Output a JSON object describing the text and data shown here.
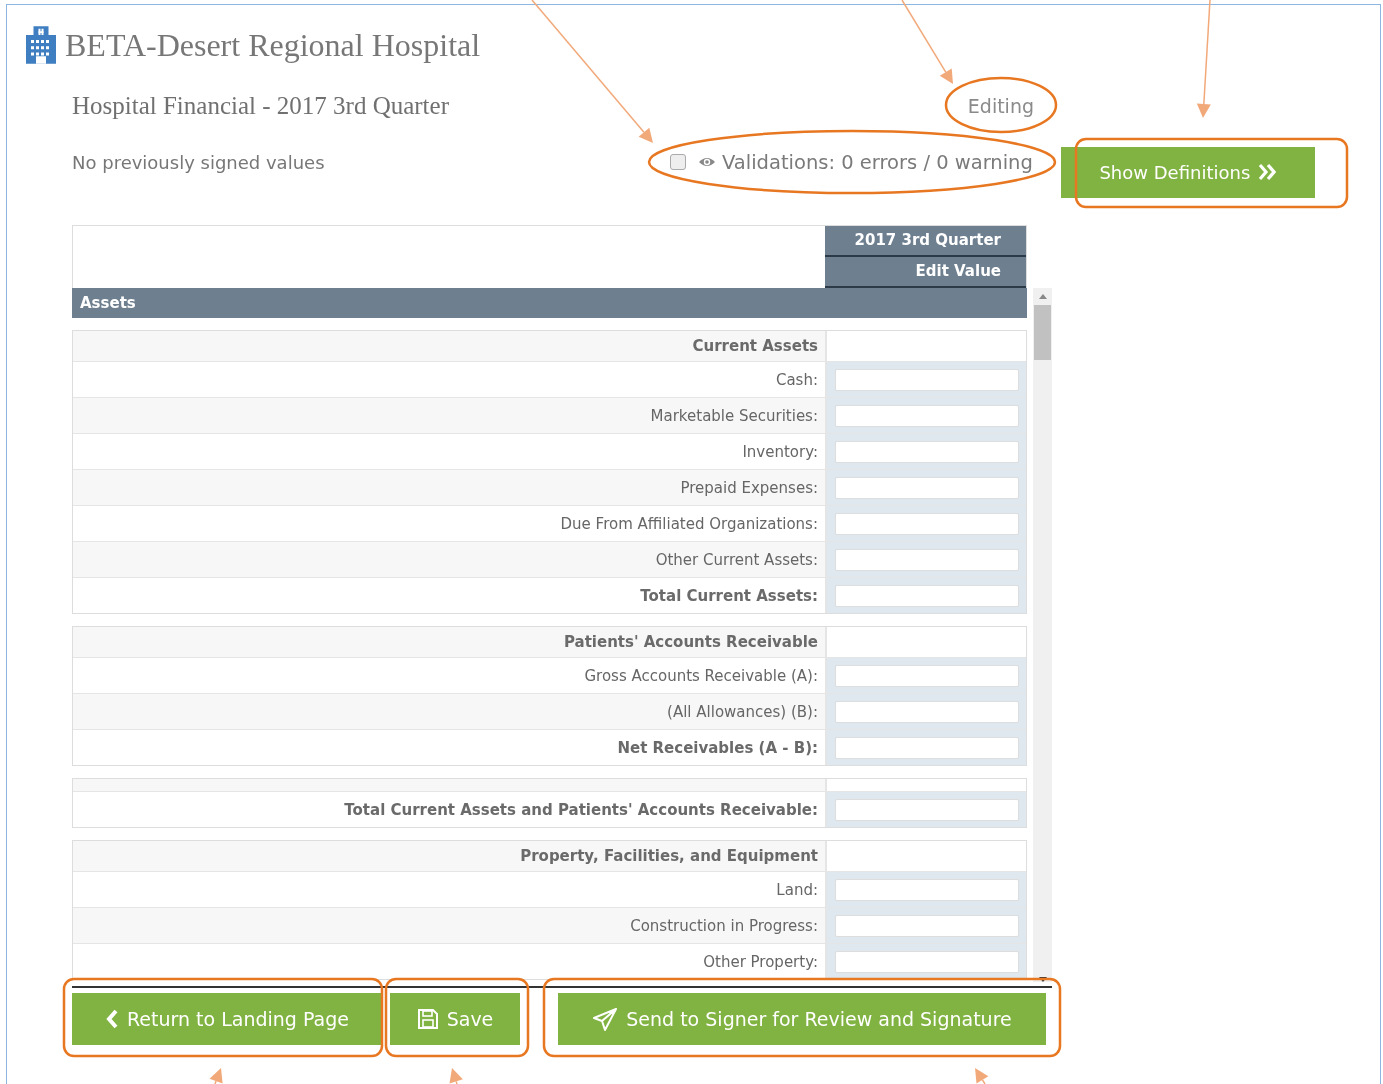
{
  "hospital": {
    "name": "BETA-Desert Regional Hospital"
  },
  "report": {
    "title": "Hospital Financial - 2017 3rd Quarter",
    "status": "Editing"
  },
  "signed_note": "No previously signed values",
  "validations": {
    "checked": false,
    "text": "Validations: 0 errors / 0 warning"
  },
  "show_definitions": "Show Definitions",
  "table": {
    "columns": [
      "2017 3rd Quarter",
      "Edit Value"
    ],
    "section": "Assets",
    "groups": [
      {
        "heading": "Current Assets",
        "rows": [
          {
            "label": "Cash:",
            "bold": false
          },
          {
            "label": "Marketable Securities:",
            "bold": false
          },
          {
            "label": "Inventory:",
            "bold": false
          },
          {
            "label": "Prepaid Expenses:",
            "bold": false
          },
          {
            "label": "Due From Affiliated Organizations:",
            "bold": false
          },
          {
            "label": "Other Current Assets:",
            "bold": false
          },
          {
            "label": "Total Current Assets:",
            "bold": true
          }
        ]
      },
      {
        "heading": "Patients' Accounts Receivable",
        "rows": [
          {
            "label": "Gross Accounts Receivable (A):",
            "bold": false
          },
          {
            "label": "(All Allowances) (B):",
            "bold": false
          },
          {
            "label": "Net Receivables (A - B):",
            "bold": true
          }
        ]
      },
      {
        "rows": [
          {
            "label": "Total Current Assets and Patients' Accounts Receivable:",
            "bold": true
          }
        ]
      },
      {
        "heading": "Property, Facilities, and Equipment",
        "rows": [
          {
            "label": "Land:",
            "bold": false
          },
          {
            "label": "Construction in Progress:",
            "bold": false
          },
          {
            "label": "Other Property:",
            "bold": false
          }
        ]
      }
    ]
  },
  "buttons": [
    {
      "label": "Return to Landing Page"
    },
    {
      "label": "Save"
    },
    {
      "label": "Send to Signer for Review and Signature"
    }
  ]
}
